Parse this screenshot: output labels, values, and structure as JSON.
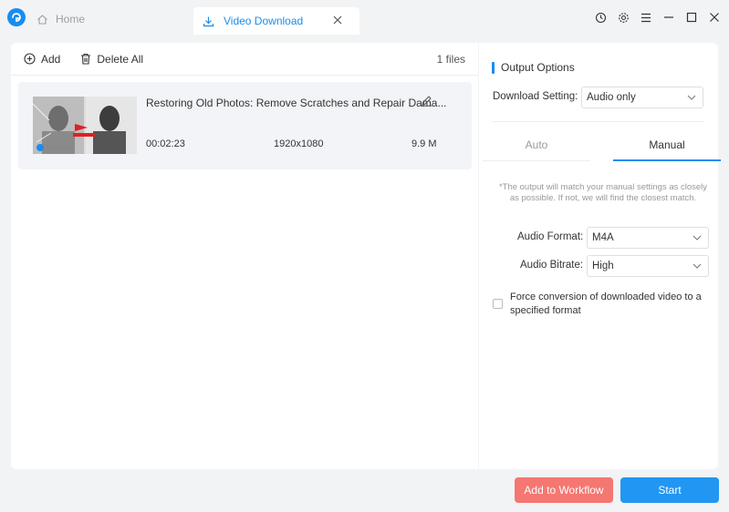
{
  "titlebar": {
    "home_tab": "Home",
    "active_tab": "Video Download"
  },
  "toolbar": {
    "add_label": "Add",
    "delete_all_label": "Delete All",
    "files_count": "1 files"
  },
  "files": [
    {
      "title": "Restoring Old Photos: Remove Scratches and Repair Dama...",
      "duration": "00:02:23",
      "resolution": "1920x1080",
      "size": "9.9 M"
    }
  ],
  "output": {
    "section_title": "Output Options",
    "download_setting_label": "Download Setting:",
    "download_setting_value": "Audio only",
    "mode_tabs": {
      "auto": "Auto",
      "manual": "Manual"
    },
    "active_mode": "Manual",
    "note": "*The output will match your manual settings as closely as possible. If not, we will find the closest match.",
    "audio_format_label": "Audio Format:",
    "audio_format_value": "M4A",
    "audio_bitrate_label": "Audio Bitrate:",
    "audio_bitrate_value": "High",
    "force_conversion_label": "Force conversion of downloaded video to a specified format",
    "force_conversion_checked": false
  },
  "actions": {
    "workflow_label": "Add to Workflow",
    "start_label": "Start"
  },
  "colors": {
    "accent": "#1a8cf0",
    "start_button": "#2196f3",
    "workflow_button": "#f57771"
  }
}
